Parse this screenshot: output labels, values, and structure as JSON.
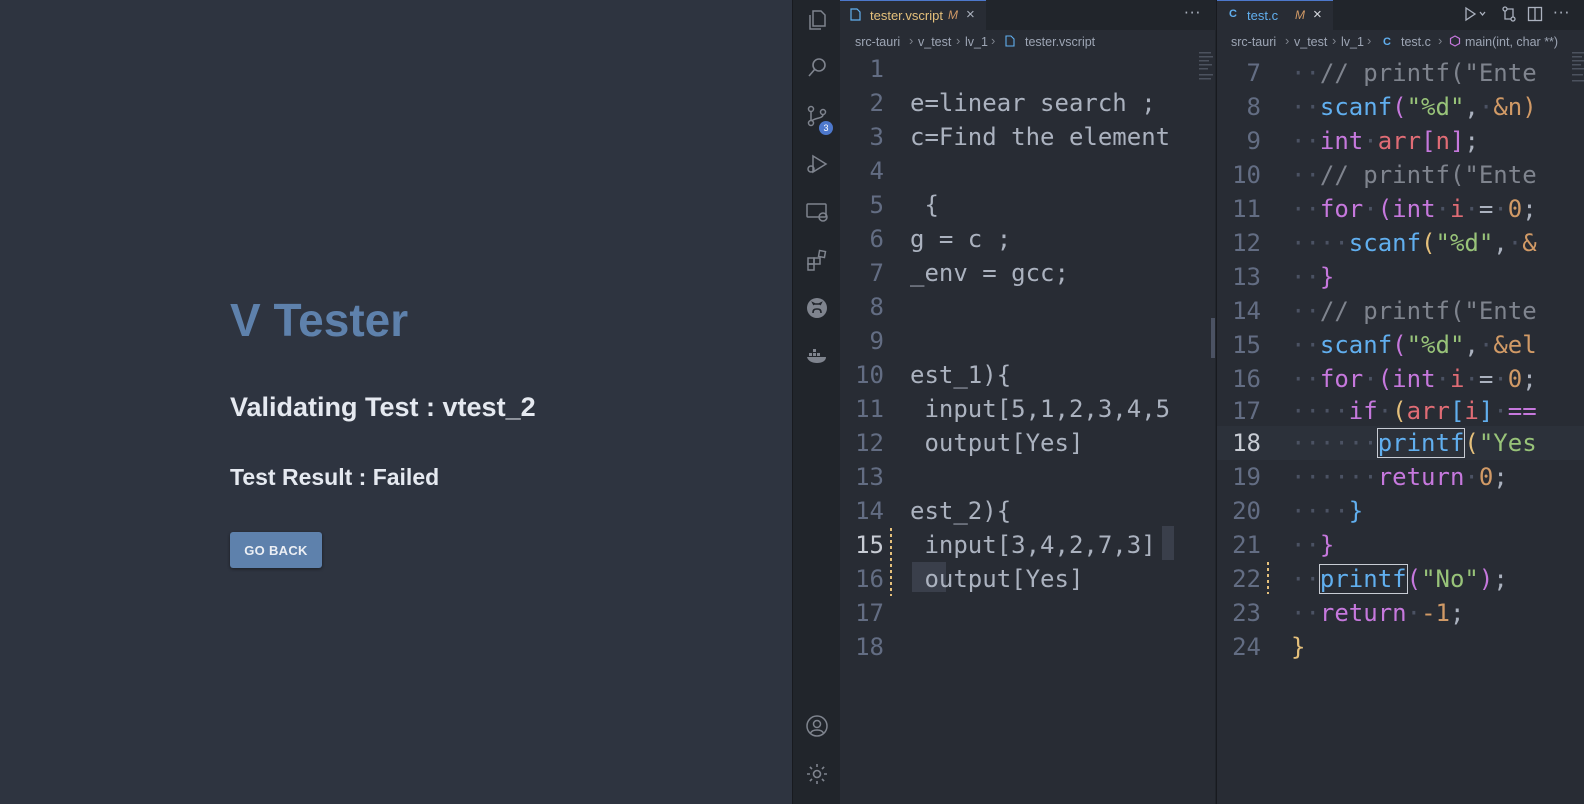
{
  "app": {
    "title": "V Tester",
    "validating_text": "Validating Test : vtest_2",
    "result_text": "Test Result : Failed",
    "go_back_label": "GO BACK"
  },
  "activity_bar": {
    "icons": [
      "files-icon",
      "search-icon",
      "source-control-icon",
      "run-debug-icon",
      "remote-explorer-icon",
      "extensions-icon",
      "github-icon",
      "docker-icon",
      "account-icon",
      "settings-gear-icon"
    ],
    "scm_badge": "3"
  },
  "left_editor": {
    "tab_label": "tester.vscript",
    "tab_modified": "M",
    "tab_close": "×",
    "more_actions": "···",
    "breadcrumb": [
      "src-tauri",
      "v_test",
      "lv_1",
      "tester.vscript"
    ],
    "line_numbers": [
      "1",
      "2",
      "3",
      "4",
      "5",
      "6",
      "7",
      "8",
      "9",
      "10",
      "11",
      "12",
      "13",
      "14",
      "15",
      "16",
      "17",
      "18"
    ],
    "active_line": "15",
    "lines": {
      "l2": "e=linear search ;",
      "l3": "c=Find the element",
      "l5": " {",
      "l6": "g = c ;",
      "l7": "_env = gcc;",
      "l10": "est_1){",
      "l11": " input[5,1,2,3,4,5",
      "l12": " output[Yes]",
      "l14": "est_2){",
      "l15": " input[3,4,2,7,3]",
      "l16": " output[Yes]"
    }
  },
  "right_editor": {
    "tab_icon": "C",
    "tab_label": "test.c",
    "tab_modified": "M",
    "tab_close": "×",
    "breadcrumb": [
      "src-tauri",
      "v_test",
      "lv_1",
      "test.c",
      "main(int, char **)"
    ],
    "crumb_c_icon": "C",
    "line_numbers": [
      "7",
      "8",
      "9",
      "10",
      "11",
      "12",
      "13",
      "14",
      "15",
      "16",
      "17",
      "18",
      "19",
      "20",
      "21",
      "22",
      "23",
      "24"
    ],
    "active_line": "18",
    "tokens": {
      "comment_printf": "// printf(\"Ente",
      "scanf": "scanf",
      "str_d": "\"%d\"",
      "amp_n": "&n)",
      "int": "int",
      "arr": "arr",
      "n": "n",
      "for": "for",
      "int_i": "int",
      "i": "i",
      "zero": "0",
      "amp": "&",
      "amp_el": "&el",
      "if": "if",
      "printf": "printf",
      "str_yes": "\"Yes",
      "return": "return",
      "str_no": "\"No\"",
      "minus_one": "-1"
    }
  },
  "colors": {
    "app_bg": "#2e3440",
    "title": "#5e81ac",
    "button": "#5e81ac",
    "editor_bg": "#282c34",
    "keyword": "#c678dd",
    "function": "#61afef",
    "string": "#98c379",
    "number": "#d19a66"
  }
}
